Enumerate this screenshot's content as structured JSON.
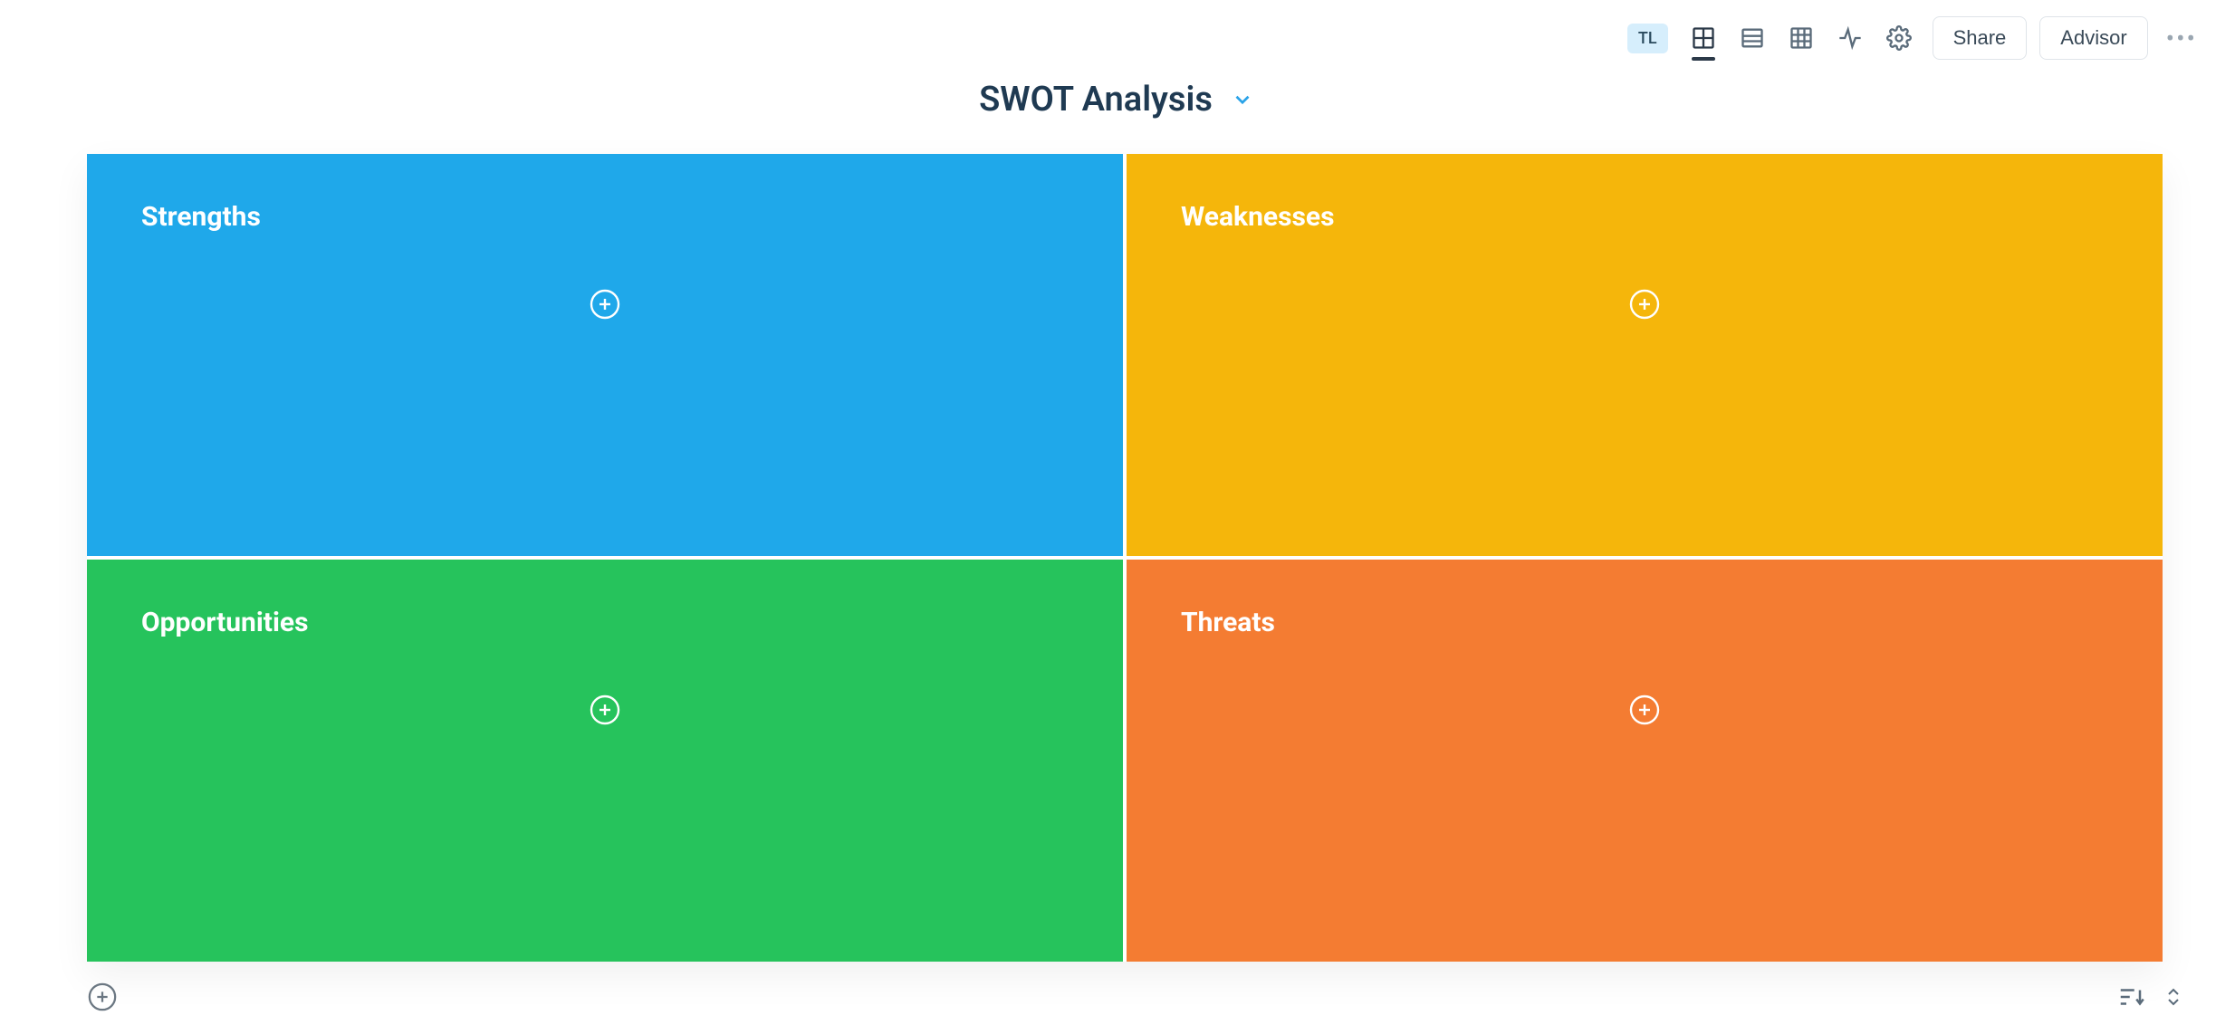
{
  "toolbar": {
    "avatar_initials": "TL",
    "share_label": "Share",
    "advisor_label": "Advisor"
  },
  "title": {
    "text": "SWOT Analysis"
  },
  "quadrants": {
    "strengths": {
      "title": "Strengths",
      "color": "#1fa8ea"
    },
    "weaknesses": {
      "title": "Weaknesses",
      "color": "#f5b60b"
    },
    "opportunities": {
      "title": "Opportunities",
      "color": "#26c35c"
    },
    "threats": {
      "title": "Threats",
      "color": "#f47c32"
    }
  }
}
